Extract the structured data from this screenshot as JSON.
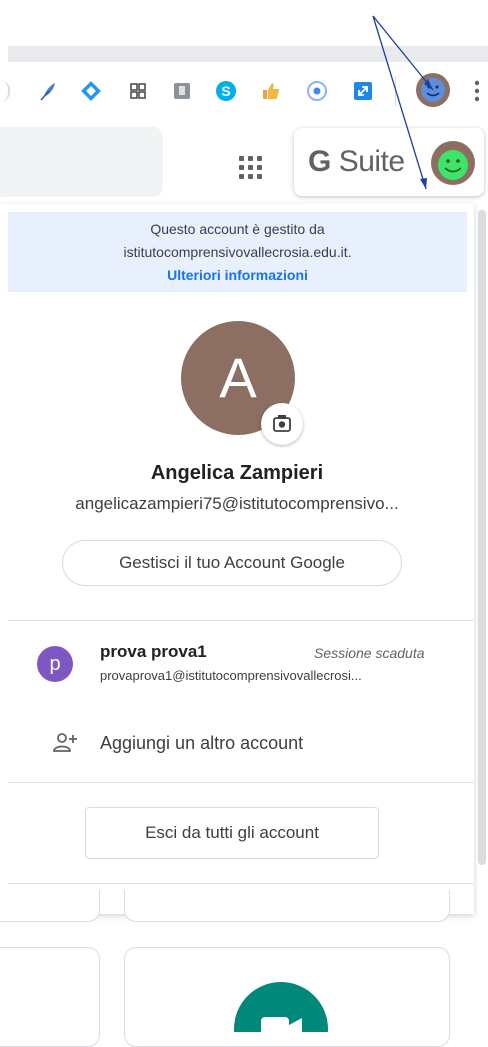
{
  "toolbar": {
    "extensions": [
      "feather-icon",
      "diamond-icon",
      "grid-icon",
      "bookmark-icon",
      "skype-icon",
      "thumbs-up-icon",
      "record-icon",
      "expand-icon"
    ],
    "profile_icon": "smiley-avatar-icon",
    "menu_icon": "vertical-dots-icon"
  },
  "header": {
    "apps_icon": "apps-grid-icon",
    "gsuite_prefix": "G",
    "gsuite_suffix": "Suite"
  },
  "managed": {
    "line1": "Questo account è gestito da",
    "line2": "istitutocomprensivovallecrosia.edu.it.",
    "link": "Ulteriori informazioni"
  },
  "profile": {
    "initial": "A",
    "name": "Angelica Zampieri",
    "email": "angelicazampieri75@istitutocomprensivo...",
    "manage_button": "Gestisci il tuo Account Google"
  },
  "other_account": {
    "initial": "p",
    "name": "prova prova1",
    "status": "Sessione scaduta",
    "email": "provaprova1@istitutocomprensivovallecrosi..."
  },
  "add_account": {
    "label": "Aggiungi un altro account"
  },
  "signout": {
    "label": "Esci da tutti gli account"
  },
  "colors": {
    "avatar_brown": "#8d6e63",
    "account_purple": "#7e57c2",
    "link_blue": "#1a73e8",
    "managed_bg": "#e8f0fe",
    "meet_green": "#00897b"
  }
}
